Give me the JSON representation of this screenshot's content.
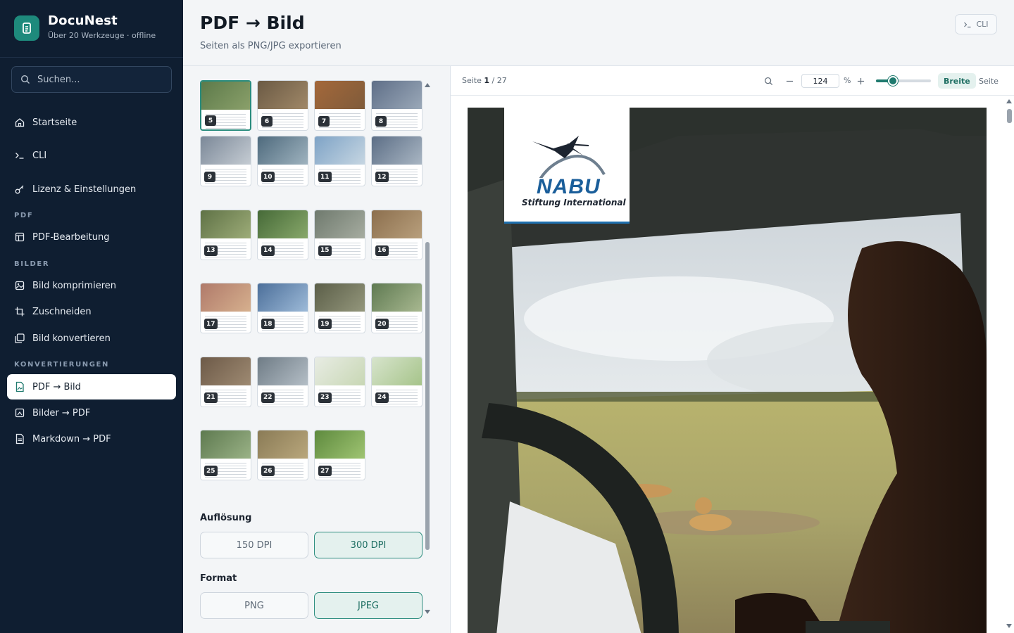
{
  "app": {
    "name": "DocuNest",
    "tagline": "Über 20 Werkzeuge · offline"
  },
  "search": {
    "placeholder": "Suchen..."
  },
  "nav": {
    "home": "Startseite",
    "cli": "CLI",
    "license": "Lizenz & Einstellungen",
    "section_pdf": "PDF",
    "pdf_edit": "PDF-Bearbeitung",
    "section_images": "BILDER",
    "compress": "Bild komprimieren",
    "crop": "Zuschneiden",
    "convert": "Bild konvertieren",
    "section_conversions": "KONVERTIERUNGEN",
    "pdf_to_image": "PDF → Bild",
    "images_to_pdf": "Bilder → PDF",
    "markdown_to_pdf": "Markdown → PDF"
  },
  "header": {
    "title": "PDF → Bild",
    "subtitle": "Seiten als PNG/JPG exportieren",
    "cli_label": "CLI"
  },
  "thumbnails": {
    "pages": [
      "5",
      "6",
      "7",
      "8",
      "9",
      "10",
      "11",
      "12",
      "13",
      "14",
      "15",
      "16",
      "17",
      "18",
      "19",
      "20",
      "21",
      "22",
      "23",
      "24",
      "25",
      "26",
      "27"
    ],
    "selected": "5"
  },
  "resolution": {
    "label": "Auflösung",
    "options": [
      "150 DPI",
      "300 DPI"
    ],
    "selected": "300 DPI"
  },
  "format": {
    "label": "Format",
    "options": [
      "PNG",
      "JPEG"
    ],
    "selected": "JPEG"
  },
  "preview": {
    "page_label": "Seite",
    "current_page": "1",
    "total_pages": "/ 27",
    "zoom": "124",
    "zoom_unit": "%",
    "fit_width": "Breite",
    "fit_page": "Seite",
    "logo": {
      "name": "NABU",
      "subtitle": "Stiftung International"
    }
  },
  "colors": {
    "sidebar": "#0f1e31",
    "accent": "#1f7a6e",
    "accent_soft": "#e4f1ee"
  }
}
